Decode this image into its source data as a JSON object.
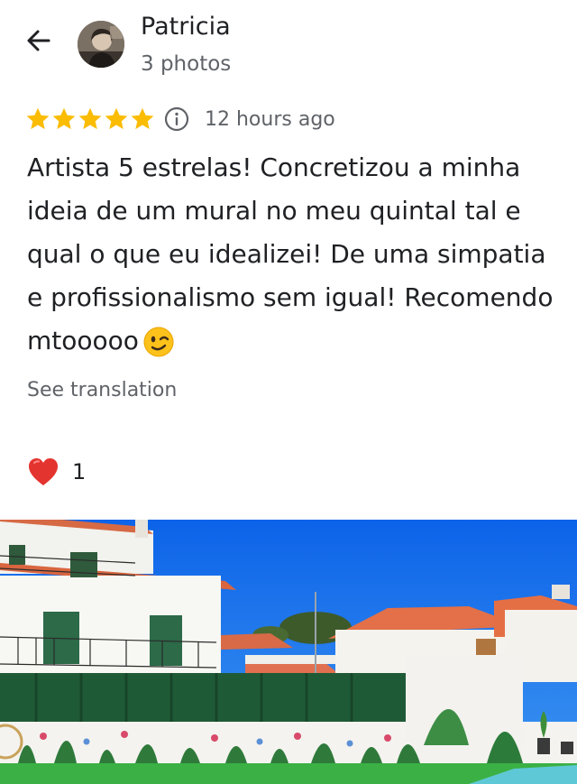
{
  "header": {
    "back_icon": "arrow-back-icon",
    "reviewer_name": "Patricia",
    "photo_count": "3 photos"
  },
  "review": {
    "rating": 5,
    "max_rating": 5,
    "star_color": "#fbbc04",
    "info_icon": "info-icon",
    "time_ago": "12 hours ago",
    "text": "Artista 5 estrelas! Concretizou a minha ideia de um mural no meu quintal tal e qual o que eu idealizei! De uma simpatia e profissionalismo sem igual! Recomendo mtooooo",
    "emoji": "winking-face-icon",
    "see_translation": "See translation"
  },
  "reactions": {
    "icon": "red-heart-icon",
    "heart_color": "#e3342f",
    "count": "1"
  }
}
